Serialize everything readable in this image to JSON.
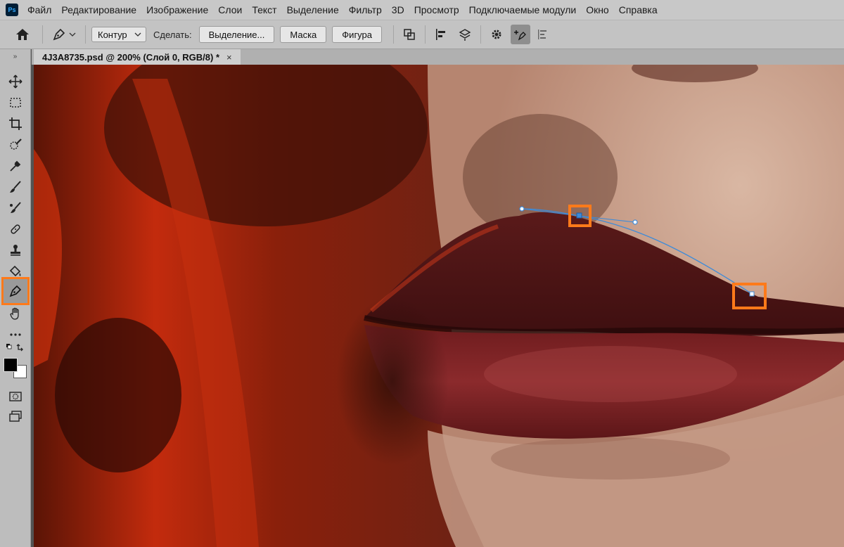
{
  "menu": [
    "Файл",
    "Редактирование",
    "Изображение",
    "Слои",
    "Текст",
    "Выделение",
    "Фильтр",
    "3D",
    "Просмотр",
    "Подключаемые модули",
    "Окно",
    "Справка"
  ],
  "app": {
    "logo": "Ps"
  },
  "options": {
    "mode": "Контур",
    "make_label": "Сделать:",
    "selection_btn": "Выделение...",
    "mask_btn": "Маска",
    "shape_btn": "Фигура"
  },
  "document": {
    "tab_title": "4J3A8735.psd @ 200% (Слой 0, RGB/8) *",
    "close": "×"
  },
  "colors": {
    "accent": "#ff7a1a",
    "path": "#3d8bd9",
    "foreground": "#000000",
    "background": "#ffffff"
  },
  "tools": [
    "move-tool",
    "marquee-tool",
    "crop-tool",
    "quick-select-tool",
    "eyedropper-tool",
    "brush-tool",
    "mixer-brush-tool",
    "eraser-tool",
    "stamp-tool",
    "paint-bucket-tool",
    "pen-tool",
    "hand-tool",
    "more-tools",
    "swap-colors",
    "color-swatches",
    "quick-mask",
    "screen-mode"
  ],
  "selected_tool": "pen-tool"
}
